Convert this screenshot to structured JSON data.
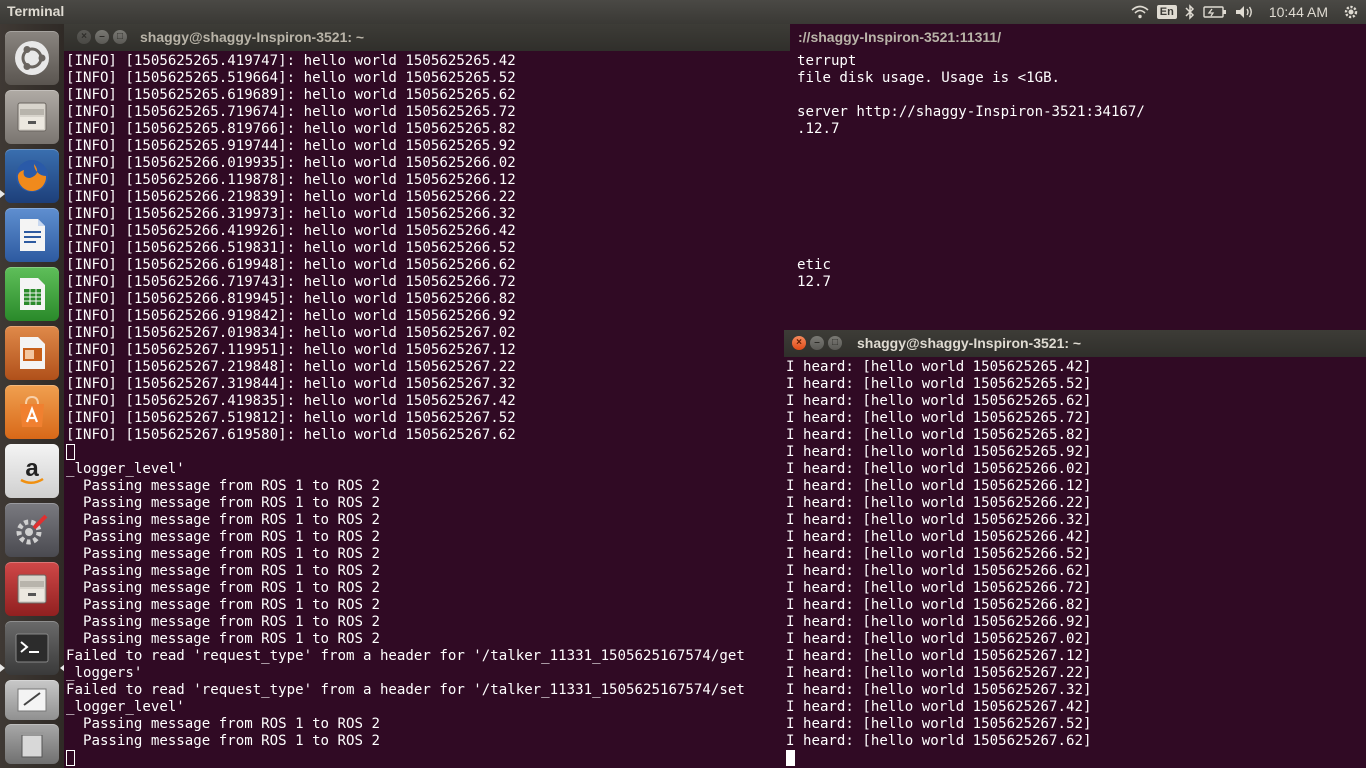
{
  "top_panel": {
    "app_title": "Terminal",
    "keyboard_layout": "En",
    "clock": "10:44 AM",
    "tray_icons": [
      "wifi-icon",
      "bluetooth-icon",
      "battery-icon",
      "volume-icon",
      "settings-gear-icon"
    ]
  },
  "launcher": {
    "items": [
      "ubuntu-dash-icon",
      "files-icon",
      "firefox-icon",
      "writer-icon",
      "calc-icon",
      "impress-icon",
      "software-center-icon",
      "amazon-icon",
      "system-settings-icon",
      "files-icon-2",
      "terminal-icon",
      "text-editor-icon",
      "trash-icon"
    ]
  },
  "bg_window": {
    "title": "://shaggy-Inspiron-3521:11311/",
    "lines": [
      "terrupt",
      "file disk usage. Usage is <1GB.",
      "",
      "server http://shaggy-Inspiron-3521:34167/",
      ".12.7",
      "",
      "",
      "",
      "",
      "",
      "",
      "",
      "etic",
      "12.7"
    ]
  },
  "left_window": {
    "title": "shaggy@shaggy-Inspiron-3521: ~",
    "lines": [
      "[INFO] [1505625265.419747]: hello world 1505625265.42",
      "[INFO] [1505625265.519664]: hello world 1505625265.52",
      "[INFO] [1505625265.619689]: hello world 1505625265.62",
      "[INFO] [1505625265.719674]: hello world 1505625265.72",
      "[INFO] [1505625265.819766]: hello world 1505625265.82",
      "[INFO] [1505625265.919744]: hello world 1505625265.92",
      "[INFO] [1505625266.019935]: hello world 1505625266.02",
      "[INFO] [1505625266.119878]: hello world 1505625266.12",
      "[INFO] [1505625266.219839]: hello world 1505625266.22",
      "[INFO] [1505625266.319973]: hello world 1505625266.32",
      "[INFO] [1505625266.419926]: hello world 1505625266.42",
      "[INFO] [1505625266.519831]: hello world 1505625266.52",
      "[INFO] [1505625266.619948]: hello world 1505625266.62",
      "[INFO] [1505625266.719743]: hello world 1505625266.72",
      "[INFO] [1505625266.819945]: hello world 1505625266.82",
      "[INFO] [1505625266.919842]: hello world 1505625266.92",
      "[INFO] [1505625267.019834]: hello world 1505625267.02",
      "[INFO] [1505625267.119951]: hello world 1505625267.12",
      "[INFO] [1505625267.219848]: hello world 1505625267.22",
      "[INFO] [1505625267.319844]: hello world 1505625267.32",
      "[INFO] [1505625267.419835]: hello world 1505625267.42",
      "[INFO] [1505625267.519812]: hello world 1505625267.52",
      "[INFO] [1505625267.619580]: hello world 1505625267.62"
    ]
  },
  "bridge_window": {
    "lines": [
      "_logger_level'",
      "  Passing message from ROS 1 to ROS 2",
      "  Passing message from ROS 1 to ROS 2",
      "  Passing message from ROS 1 to ROS 2",
      "  Passing message from ROS 1 to ROS 2",
      "  Passing message from ROS 1 to ROS 2",
      "  Passing message from ROS 1 to ROS 2",
      "  Passing message from ROS 1 to ROS 2",
      "  Passing message from ROS 1 to ROS 2",
      "  Passing message from ROS 1 to ROS 2",
      "  Passing message from ROS 1 to ROS 2",
      "Failed to read 'request_type' from a header for '/talker_11331_1505625167574/get",
      "_loggers'",
      "Failed to read 'request_type' from a header for '/talker_11331_1505625167574/set",
      "_logger_level'",
      "  Passing message from ROS 1 to ROS 2",
      "  Passing message from ROS 1 to ROS 2"
    ]
  },
  "right_window": {
    "title": "shaggy@shaggy-Inspiron-3521: ~",
    "lines": [
      "I heard: [hello world 1505625265.42]",
      "I heard: [hello world 1505625265.52]",
      "I heard: [hello world 1505625265.62]",
      "I heard: [hello world 1505625265.72]",
      "I heard: [hello world 1505625265.82]",
      "I heard: [hello world 1505625265.92]",
      "I heard: [hello world 1505625266.02]",
      "I heard: [hello world 1505625266.12]",
      "I heard: [hello world 1505625266.22]",
      "I heard: [hello world 1505625266.32]",
      "I heard: [hello world 1505625266.42]",
      "I heard: [hello world 1505625266.52]",
      "I heard: [hello world 1505625266.62]",
      "I heard: [hello world 1505625266.72]",
      "I heard: [hello world 1505625266.82]",
      "I heard: [hello world 1505625266.92]",
      "I heard: [hello world 1505625267.02]",
      "I heard: [hello world 1505625267.12]",
      "I heard: [hello world 1505625267.22]",
      "I heard: [hello world 1505625267.32]",
      "I heard: [hello world 1505625267.42]",
      "I heard: [hello world 1505625267.52]",
      "I heard: [hello world 1505625267.62]"
    ]
  }
}
